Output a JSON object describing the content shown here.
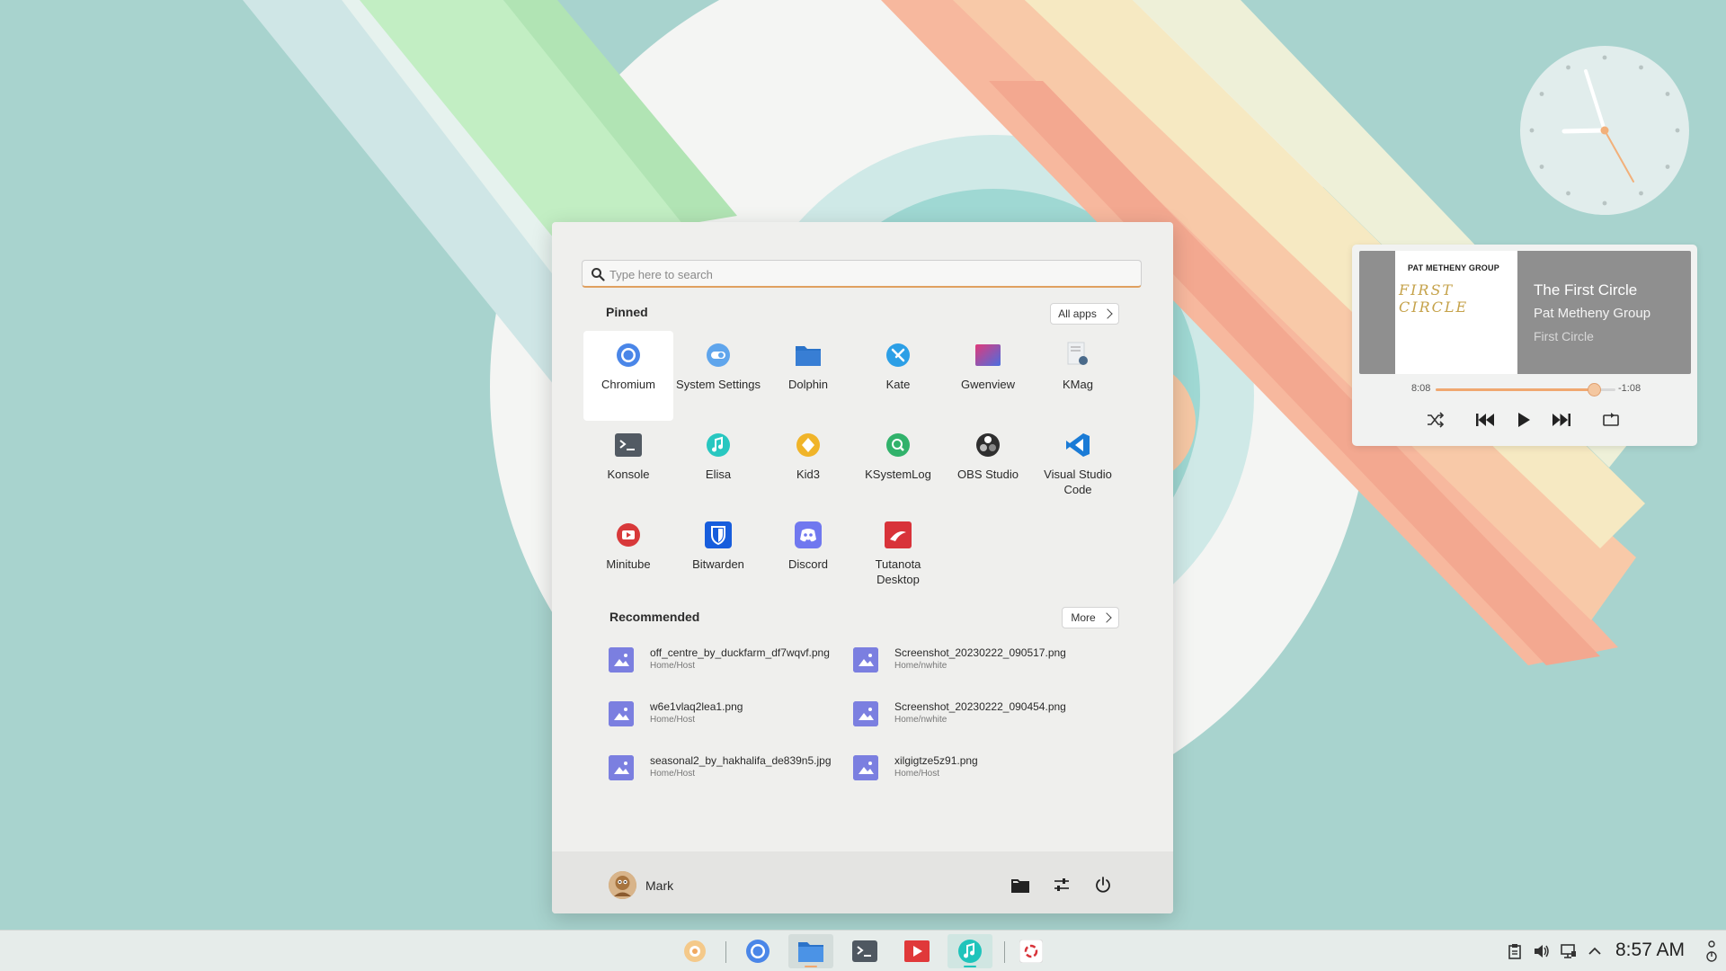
{
  "colors": {
    "accent": "#f0a870",
    "desktop": "#a6d2cd",
    "file_icon": "#7b7fe0"
  },
  "start_menu": {
    "search": {
      "placeholder": "Type here to search"
    },
    "pinned": {
      "title": "Pinned",
      "all_apps_label": "All apps",
      "apps": [
        {
          "label": "Chromium",
          "icon": "chromium-icon",
          "color": "#4a86e8"
        },
        {
          "label": "System Settings",
          "icon": "settings-icon",
          "color": "#5fa5ec"
        },
        {
          "label": "Dolphin",
          "icon": "folder-icon",
          "color": "#3b80d6"
        },
        {
          "label": "Kate",
          "icon": "kate-icon",
          "color": "#2c9fe6"
        },
        {
          "label": "Gwenview",
          "icon": "gwenview-icon",
          "color": "#a24cc9"
        },
        {
          "label": "KMag",
          "icon": "kmag-icon",
          "color": "#cfd3d8"
        },
        {
          "label": "Konsole",
          "icon": "terminal-icon",
          "color": "#525a63"
        },
        {
          "label": "Elisa",
          "icon": "music-icon",
          "color": "#28c7c0"
        },
        {
          "label": "Kid3",
          "icon": "kid3-icon",
          "color": "#f0b429"
        },
        {
          "label": "KSystemLog",
          "icon": "ksystemlog-icon",
          "color": "#31b26b"
        },
        {
          "label": "OBS Studio",
          "icon": "obs-icon",
          "color": "#2f2f2f"
        },
        {
          "label": "Visual Studio Code",
          "icon": "vscode-icon",
          "color": "#1a7bd6"
        },
        {
          "label": "Minitube",
          "icon": "minitube-icon",
          "color": "#d8393a"
        },
        {
          "label": "Bitwarden",
          "icon": "bitwarden-icon",
          "color": "#175ddc"
        },
        {
          "label": "Discord",
          "icon": "discord-icon",
          "color": "#7078ef"
        },
        {
          "label": "Tutanota Desktop",
          "icon": "tutanota-icon",
          "color": "#d8333a"
        }
      ]
    },
    "recommended": {
      "title": "Recommended",
      "more_label": "More",
      "files": [
        {
          "name": "off_centre_by_duckfarm_df7wqvf.png",
          "path": "Home/Host"
        },
        {
          "name": "Screenshot_20230222_090517.png",
          "path": "Home/nwhite"
        },
        {
          "name": "w6e1vlaq2lea1.png",
          "path": "Home/Host"
        },
        {
          "name": "Screenshot_20230222_090454.png",
          "path": "Home/nwhite"
        },
        {
          "name": "seasonal2_by_hakhalifa_de839n5.jpg",
          "path": "Home/Host"
        },
        {
          "name": "xilgigtze5z91.png",
          "path": "Home/Host"
        }
      ]
    },
    "user": {
      "name": "Mark"
    }
  },
  "media_player": {
    "cover_band": "PAT METHENY GROUP",
    "cover_album": "FIRST CIRCLE",
    "title": "The First Circle",
    "artist": "Pat Metheny Group",
    "album": "First Circle",
    "position": "8:08",
    "remaining": "-1:08",
    "progress": 0.88
  },
  "taskbar": {
    "apps": [
      "app-launcher-icon",
      "chromium-icon",
      "folder-icon",
      "terminal-icon",
      "minitube-icon",
      "music-icon",
      "tutanota-icon"
    ],
    "clock": "8:57 AM"
  }
}
